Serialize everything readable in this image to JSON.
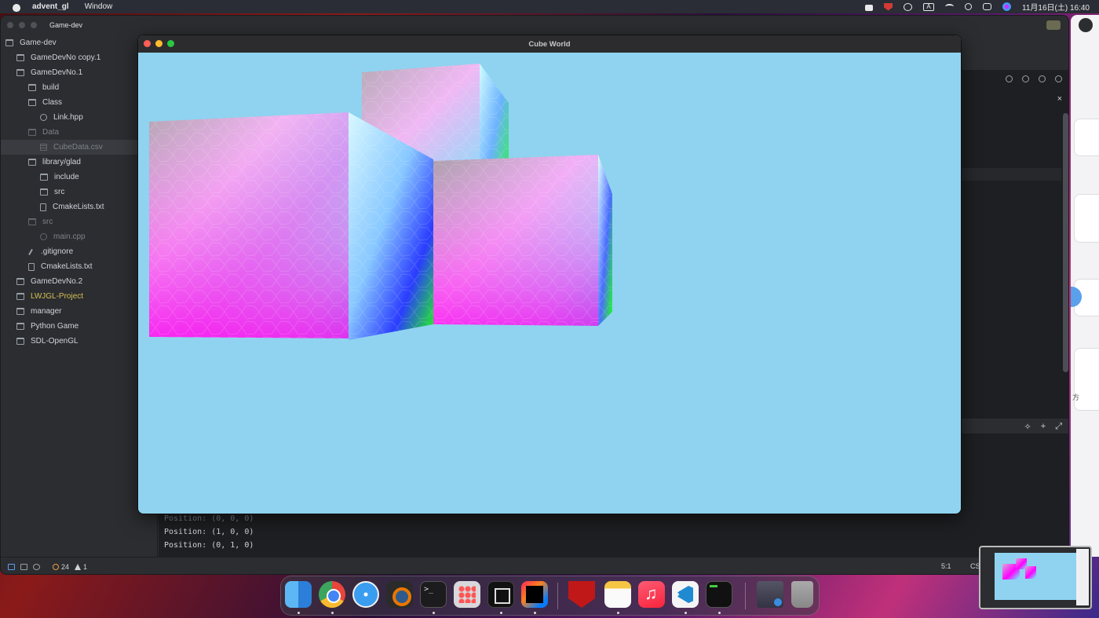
{
  "menubar": {
    "app_name": "advent_gl",
    "menu": "Window",
    "datetime": "11月16日(土)  16:40",
    "input_label": "A"
  },
  "ide": {
    "project_label": "Game-dev",
    "tree": [
      {
        "label": "Game-dev",
        "kind": "folder",
        "state": "normal"
      },
      {
        "label": "GameDevNo copy.1",
        "kind": "folder",
        "state": "normal"
      },
      {
        "label": "GameDevNo.1",
        "kind": "folder",
        "state": "normal"
      },
      {
        "label": "build",
        "kind": "folder",
        "state": "normal"
      },
      {
        "label": "Class",
        "kind": "folder",
        "state": "normal"
      },
      {
        "label": "Link.hpp",
        "kind": "file-c",
        "state": "normal"
      },
      {
        "label": "Data",
        "kind": "folder",
        "state": "dim"
      },
      {
        "label": "CubeData.csv",
        "kind": "csv",
        "state": "dim-selected"
      },
      {
        "label": "library/glad",
        "kind": "folder",
        "state": "normal"
      },
      {
        "label": "include",
        "kind": "folder",
        "state": "normal"
      },
      {
        "label": "src",
        "kind": "folder",
        "state": "normal"
      },
      {
        "label": "CmakeLists.txt",
        "kind": "txt",
        "state": "normal"
      },
      {
        "label": "src",
        "kind": "folder",
        "state": "dim"
      },
      {
        "label": "main.cpp",
        "kind": "file-c",
        "state": "dim"
      },
      {
        "label": ".gitignore",
        "kind": "git",
        "state": "normal"
      },
      {
        "label": "CmakeLists.txt",
        "kind": "txt",
        "state": "normal"
      },
      {
        "label": "GameDevNo.2",
        "kind": "folder",
        "state": "normal"
      },
      {
        "label": "LWJGL-Project",
        "kind": "folder",
        "state": "yellow"
      },
      {
        "label": "manager",
        "kind": "folder",
        "state": "normal"
      },
      {
        "label": "Python Game",
        "kind": "folder",
        "state": "normal"
      },
      {
        "label": "SDL-OpenGL",
        "kind": "folder",
        "state": "normal"
      }
    ],
    "console_lines": [
      "Position: (0, 0, 0)",
      "Position: (1, 0, 0)",
      "Position: (0, 1, 0)"
    ],
    "status": {
      "warnings": "24",
      "alerts": "1",
      "cursor": "5:1",
      "encoding": "CS"
    },
    "close_glyph": "×"
  },
  "right_window": {
    "hint": "方"
  },
  "cube_window": {
    "title": "Cube World",
    "background": "#8fd3f0"
  },
  "dock": {
    "apps": [
      "finder",
      "chrome",
      "safari",
      "blender",
      "terminal",
      "launchpad",
      "zed",
      "intellij",
      "mcafee",
      "notes",
      "music",
      "vscode",
      "console",
      "downloads",
      "trash"
    ],
    "terminal_prompt": ">_"
  }
}
